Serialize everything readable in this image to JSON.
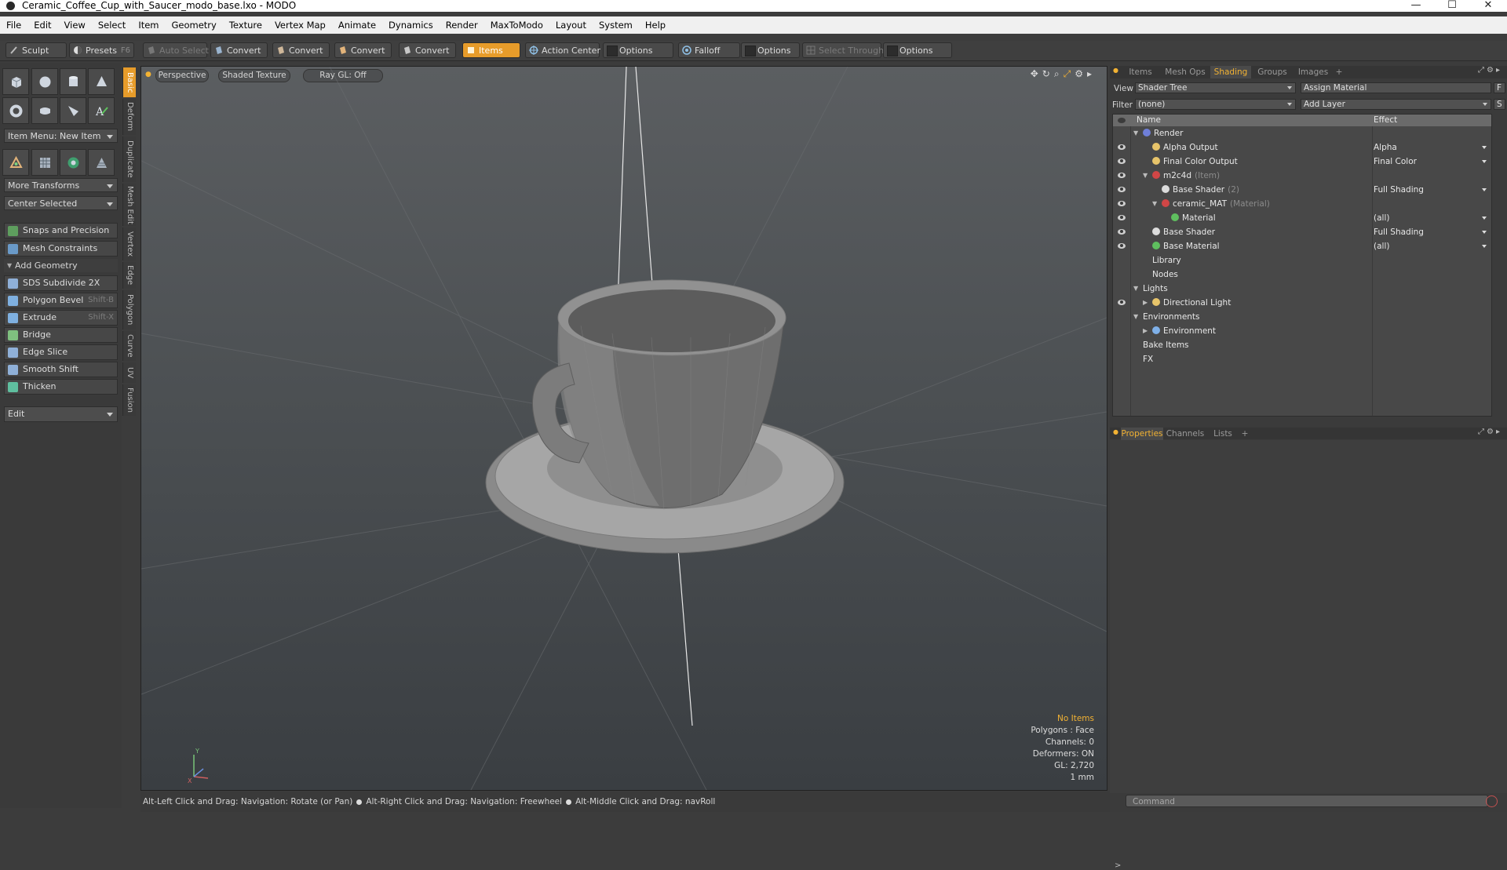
{
  "window": {
    "title": "Ceramic_Coffee_Cup_with_Saucer_modo_base.lxo - MODO",
    "min": "—",
    "max": "☐",
    "close": "✕"
  },
  "menu": [
    "File",
    "Edit",
    "View",
    "Select",
    "Item",
    "Geometry",
    "Texture",
    "Vertex Map",
    "Animate",
    "Dynamics",
    "Render",
    "MaxToModo",
    "Layout",
    "System",
    "Help"
  ],
  "toolbar": {
    "sculpt": "Sculpt",
    "presets": "Presets",
    "presets_key": "F6",
    "auto_select": "Auto Select",
    "convert1": "Convert",
    "convert2": "Convert",
    "convert3": "Convert",
    "convert4": "Convert",
    "items": "Items",
    "action_center": "Action Center",
    "options1": "Options",
    "falloff": "Falloff",
    "options2": "Options",
    "select_through": "Select Through",
    "options3": "Options"
  },
  "left": {
    "item_menu": "Item Menu: New Item",
    "more_transforms": "More Transforms",
    "center_selected": "Center Selected",
    "snaps": "Snaps and Precision",
    "mesh_constraints": "Mesh Constraints",
    "add_geometry": "Add Geometry",
    "tools": [
      {
        "label": "SDS Subdivide 2X",
        "key": ""
      },
      {
        "label": "Polygon Bevel",
        "key": "Shift-B"
      },
      {
        "label": "Extrude",
        "key": "Shift-X"
      },
      {
        "label": "Bridge",
        "key": ""
      },
      {
        "label": "Edge Slice",
        "key": ""
      },
      {
        "label": "Smooth Shift",
        "key": ""
      },
      {
        "label": "Thicken",
        "key": ""
      }
    ],
    "edit": "Edit"
  },
  "vtabs": [
    "Basic",
    "Deform",
    "Duplicate",
    "Mesh Edit",
    "Vertex",
    "Edge",
    "Polygon",
    "Curve",
    "UV",
    "Fusion"
  ],
  "viewport": {
    "view": "Perspective",
    "shading": "Shaded Texture",
    "raygl": "Ray GL: Off",
    "info": {
      "selection": "No Items",
      "polygons": "Polygons : Face",
      "channels": "Channels: 0",
      "deformers": "Deformers: ON",
      "gl": "GL: 2,720",
      "unit": "1 mm"
    },
    "axis_y": "Y",
    "axis_x": "X"
  },
  "status": {
    "hint1": "Alt-Left Click and Drag: Navigation: Rotate (or Pan)",
    "hint2": "Alt-Right Click and Drag: Navigation: Freewheel",
    "hint3": "Alt-Middle Click and Drag: navRoll"
  },
  "right": {
    "tabs": [
      "Items",
      "Mesh Ops",
      "Shading",
      "Groups",
      "Images",
      "+"
    ],
    "view_label": "View",
    "view_value": "Shader Tree",
    "assign_material": "Assign Material",
    "f_btn": "F",
    "filter_label": "Filter",
    "filter_value": "(none)",
    "add_layer": "Add Layer",
    "s_btn": "S",
    "col_name": "Name",
    "col_effect": "Effect",
    "tree": [
      {
        "name": "Render",
        "sub": "",
        "effect": "",
        "eye": false,
        "indent": 0,
        "tri": "▼",
        "color": "#6f7fd8"
      },
      {
        "name": "Alpha Output",
        "sub": "",
        "effect": "Alpha",
        "eye": true,
        "indent": 1,
        "tri": "",
        "color": "#e7c46a"
      },
      {
        "name": "Final Color Output",
        "sub": "",
        "effect": "Final Color",
        "eye": true,
        "indent": 1,
        "tri": "",
        "color": "#e7c46a"
      },
      {
        "name": "m2c4d",
        "sub": "(Item)",
        "effect": "",
        "eye": true,
        "indent": 1,
        "tri": "▼",
        "color": "#d04646"
      },
      {
        "name": "Base Shader",
        "sub": "(2)",
        "effect": "Full Shading",
        "eye": true,
        "indent": 2,
        "tri": "",
        "color": "#dcdcdc"
      },
      {
        "name": "ceramic_MAT",
        "sub": "(Material)",
        "effect": "",
        "eye": true,
        "indent": 2,
        "tri": "▼",
        "color": "#d04646"
      },
      {
        "name": "Material",
        "sub": "",
        "effect": "(all)",
        "eye": true,
        "indent": 3,
        "tri": "",
        "color": "#5fbf5f"
      },
      {
        "name": "Base Shader",
        "sub": "",
        "effect": "Full Shading",
        "eye": true,
        "indent": 1,
        "tri": "",
        "color": "#dcdcdc"
      },
      {
        "name": "Base Material",
        "sub": "",
        "effect": "(all)",
        "eye": true,
        "indent": 1,
        "tri": "",
        "color": "#5fbf5f"
      },
      {
        "name": "Library",
        "sub": "",
        "effect": "",
        "eye": false,
        "indent": 1,
        "tri": "",
        "color": ""
      },
      {
        "name": "Nodes",
        "sub": "",
        "effect": "",
        "eye": false,
        "indent": 1,
        "tri": "",
        "color": ""
      },
      {
        "name": "Lights",
        "sub": "",
        "effect": "",
        "eye": false,
        "indent": 0,
        "tri": "▼",
        "color": ""
      },
      {
        "name": "Directional Light",
        "sub": "",
        "effect": "",
        "eye": true,
        "indent": 1,
        "tri": "▶",
        "color": "#e7c46a"
      },
      {
        "name": "Environments",
        "sub": "",
        "effect": "",
        "eye": false,
        "indent": 0,
        "tri": "▼",
        "color": ""
      },
      {
        "name": "Environment",
        "sub": "",
        "effect": "",
        "eye": false,
        "indent": 1,
        "tri": "▶",
        "color": "#7fb0e8"
      },
      {
        "name": "Bake Items",
        "sub": "",
        "effect": "",
        "eye": false,
        "indent": 0,
        "tri": "",
        "color": ""
      },
      {
        "name": "FX",
        "sub": "",
        "effect": "",
        "eye": false,
        "indent": 0,
        "tri": "",
        "color": ""
      }
    ],
    "prop_tabs": [
      "Properties",
      "Channels",
      "Lists",
      "+"
    ],
    "command_placeholder": "Command"
  }
}
